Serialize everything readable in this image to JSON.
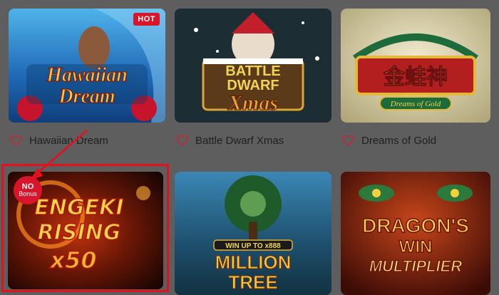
{
  "games": [
    {
      "title": "Hawaiian Dream",
      "art_lines": [
        "Hawaiian",
        "Dream"
      ],
      "badge": "HOT",
      "theme": "#2d7fc4"
    },
    {
      "title": "Battle Dwarf Xmas",
      "art_lines": [
        "BATTLE",
        "DWARF",
        "Xmas"
      ],
      "theme": "#1c2d33"
    },
    {
      "title": "Dreams of Gold",
      "art_lines": [
        "金蛙神",
        "Dreams of Gold"
      ],
      "theme": "#cdbf8d"
    },
    {
      "title": "Engeki Rising x50",
      "art_lines": [
        "ENGEKI",
        "RISING",
        "x50"
      ],
      "badge_line1": "NO",
      "badge_line2": "Bonus",
      "theme": "#3a0d04"
    },
    {
      "title": "Million Tree",
      "art_lines": [
        "WIN UP TO x888",
        "MILLION",
        "TREE"
      ],
      "theme": "#1f4a66"
    },
    {
      "title": "Dragon's Win Multiplier",
      "art_lines": [
        "DRAGON'S",
        "WIN",
        "MULTIPLIER"
      ],
      "theme": "#7a1a0c"
    }
  ],
  "colors": {
    "heart": "#c1283a",
    "highlight": "#e4101c",
    "backdrop": "#5e5e5e"
  },
  "icons": {
    "favorite": "heart-icon"
  }
}
